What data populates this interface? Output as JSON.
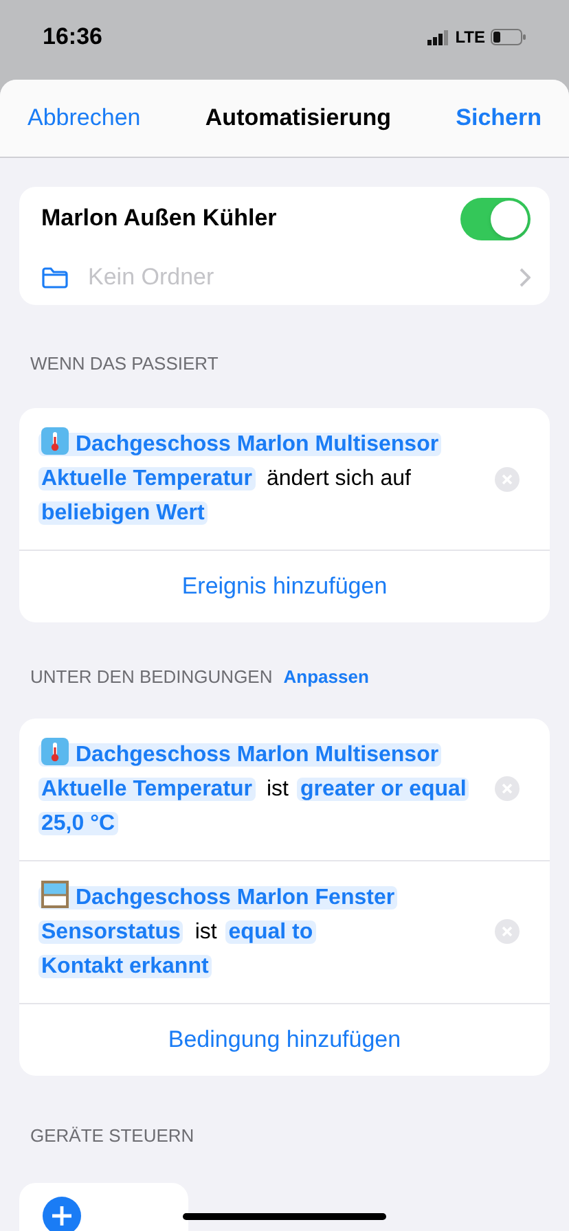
{
  "status_bar": {
    "time": "16:36",
    "network": "LTE"
  },
  "nav": {
    "cancel": "Abbrechen",
    "title": "Automatisierung",
    "save": "Sichern"
  },
  "automation": {
    "name": "Marlon Außen Kühler",
    "on": true,
    "folder_placeholder": "Kein Ordner"
  },
  "trigger_section": {
    "header": "WENN DAS PASSIERT",
    "events": [
      {
        "tokens": [
          {
            "kind": "temperature-device",
            "text": "Dachgeschoss Marlon Multisensor"
          },
          {
            "kind": "token",
            "text": "Aktuelle Temperatur"
          },
          {
            "kind": "text",
            "text": "ändert sich auf"
          },
          {
            "kind": "token",
            "text": "beliebigen Wert"
          }
        ]
      }
    ],
    "add": "Ereignis hinzufügen"
  },
  "condition_section": {
    "header": "UNTER DEN BEDINGUNGEN",
    "action": "Anpassen",
    "conditions": [
      {
        "tokens": [
          {
            "kind": "temperature-device",
            "text": "Dachgeschoss Marlon Multisensor"
          },
          {
            "kind": "token",
            "text": "Aktuelle Temperatur"
          },
          {
            "kind": "text",
            "text": "ist"
          },
          {
            "kind": "token",
            "text": "greater or equal"
          },
          {
            "kind": "token",
            "text": "25,0 °C"
          }
        ]
      },
      {
        "tokens": [
          {
            "kind": "window-device",
            "text": "Dachgeschoss Marlon Fenster"
          },
          {
            "kind": "token",
            "text": "Sensorstatus"
          },
          {
            "kind": "text",
            "text": "ist"
          },
          {
            "kind": "token",
            "text": "equal to"
          },
          {
            "kind": "token",
            "text": "Kontakt erkannt"
          }
        ]
      }
    ],
    "add": "Bedingung hinzufügen"
  },
  "devices_section": {
    "header": "GERÄTE STEUERN"
  }
}
